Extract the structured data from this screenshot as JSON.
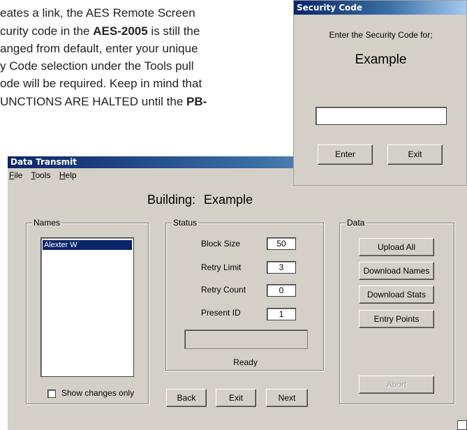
{
  "document": {
    "line1_pre": "eates a link, the AES Remote Screen",
    "line2_pre": "curity code in the ",
    "line2_bold": "AES-2005",
    "line2_post": " is still the",
    "line3": "anged from default, enter your unique",
    "line4": "y Code selection under the Tools pull",
    "line5": "ode will be required. Keep in mind that",
    "line6_pre": "UNCTIONS ARE HALTED until the ",
    "line6_bold": "PB-"
  },
  "security_dialog": {
    "title": "Security Code",
    "prompt": "Enter the Security Code for;",
    "building_name": "Example",
    "input_value": "",
    "enter_label": "Enter",
    "exit_label": "Exit"
  },
  "data_transmit": {
    "title": "Data Transmit",
    "menu": [
      {
        "key": "F",
        "rest": "ile"
      },
      {
        "key": "T",
        "rest": "ools"
      },
      {
        "key": "H",
        "rest": "elp"
      }
    ],
    "building_label": "Building:",
    "building_value": "Example",
    "names": {
      "group_label": "Names",
      "items": [
        "Alexter W"
      ],
      "show_changes_label": "Show changes only",
      "show_changes_checked": false
    },
    "status": {
      "group_label": "Status",
      "block_size_label": "Block Size",
      "block_size": "50",
      "retry_limit_label": "Retry Limit",
      "retry_limit": "3",
      "retry_count_label": "Retry Count",
      "retry_count": "0",
      "present_id_label": "Present ID",
      "present_id": "1",
      "progress": 0,
      "status_text": "Ready"
    },
    "data": {
      "group_label": "Data",
      "upload_all": "Upload All",
      "download_names": "Download Names",
      "download_stats": "Download Stats",
      "entry_points": "Entry Points",
      "abort": "Abort"
    },
    "nav": {
      "back": "Back",
      "exit": "Exit",
      "next": "Next"
    }
  },
  "colors": {
    "titlebar_start": "#0a246a",
    "titlebar_end": "#a6caf0",
    "window_face": "#d4d0c8",
    "selection": "#0a246a"
  }
}
